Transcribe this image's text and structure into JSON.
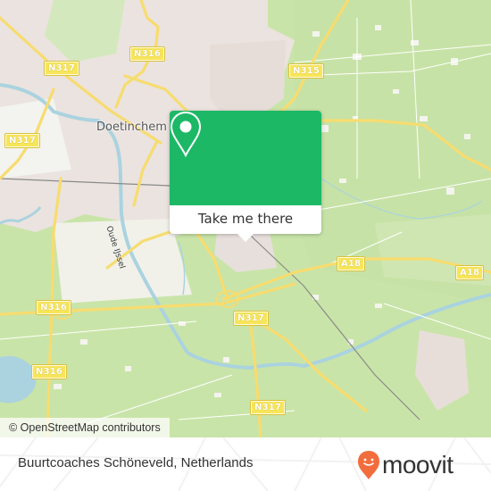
{
  "map": {
    "city_label": "Doetinchem",
    "river_label": "Oude IJssel",
    "road_shields": [
      {
        "id": "n316-top",
        "label": "N316"
      },
      {
        "id": "n317-nw",
        "label": "N317"
      },
      {
        "id": "n315",
        "label": "N315"
      },
      {
        "id": "n317-w",
        "label": "N317"
      },
      {
        "id": "a18-center",
        "label": "A18"
      },
      {
        "id": "a18-east",
        "label": "A18"
      },
      {
        "id": "n316-west",
        "label": "N316"
      },
      {
        "id": "n317-center",
        "label": "N317"
      },
      {
        "id": "n316-sw",
        "label": "N316"
      },
      {
        "id": "n317-south",
        "label": "N317"
      }
    ],
    "attribution": "© OpenStreetMap contributors"
  },
  "popup": {
    "icon": "map-pin-icon",
    "button_label": "Take me there",
    "color": "#1db866"
  },
  "footer": {
    "place_name": "Buurtcoaches Schöneveld, Netherlands",
    "logo_text": "moovit",
    "logo_color": "#f26d3d"
  }
}
